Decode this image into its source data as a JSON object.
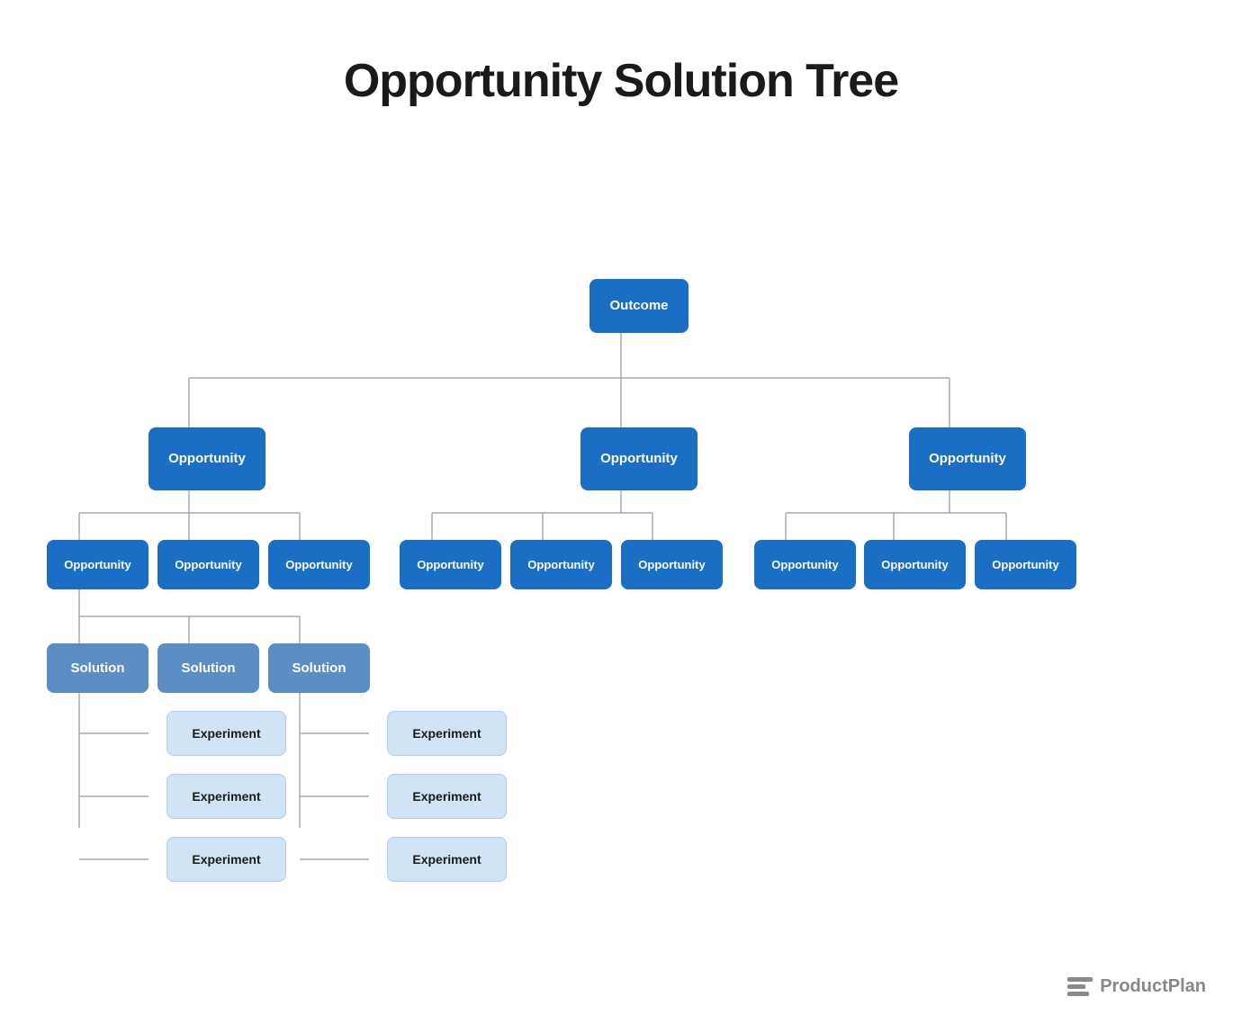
{
  "title": "Opportunity Solution Tree",
  "nodes": {
    "outcome": {
      "label": "Outcome"
    },
    "opportunity_l1": [
      {
        "label": "Opportunity"
      },
      {
        "label": "Opportunity"
      },
      {
        "label": "Opportunity"
      }
    ],
    "opportunity_l2_left": [
      {
        "label": "Opportunity"
      },
      {
        "label": "Opportunity"
      },
      {
        "label": "Opportunity"
      }
    ],
    "opportunity_l2_mid": [
      {
        "label": "Opportunity"
      },
      {
        "label": "Opportunity"
      },
      {
        "label": "Opportunity"
      }
    ],
    "opportunity_l2_right": [
      {
        "label": "Opportunity"
      },
      {
        "label": "Opportunity"
      },
      {
        "label": "Opportunity"
      }
    ],
    "solutions": [
      {
        "label": "Solution"
      },
      {
        "label": "Solution"
      },
      {
        "label": "Solution"
      }
    ],
    "experiments_left": [
      {
        "label": "Experiment"
      },
      {
        "label": "Experiment"
      },
      {
        "label": "Experiment"
      }
    ],
    "experiments_right": [
      {
        "label": "Experiment"
      },
      {
        "label": "Experiment"
      },
      {
        "label": "Experiment"
      }
    ]
  },
  "logo": {
    "text": "ProductPlan"
  }
}
